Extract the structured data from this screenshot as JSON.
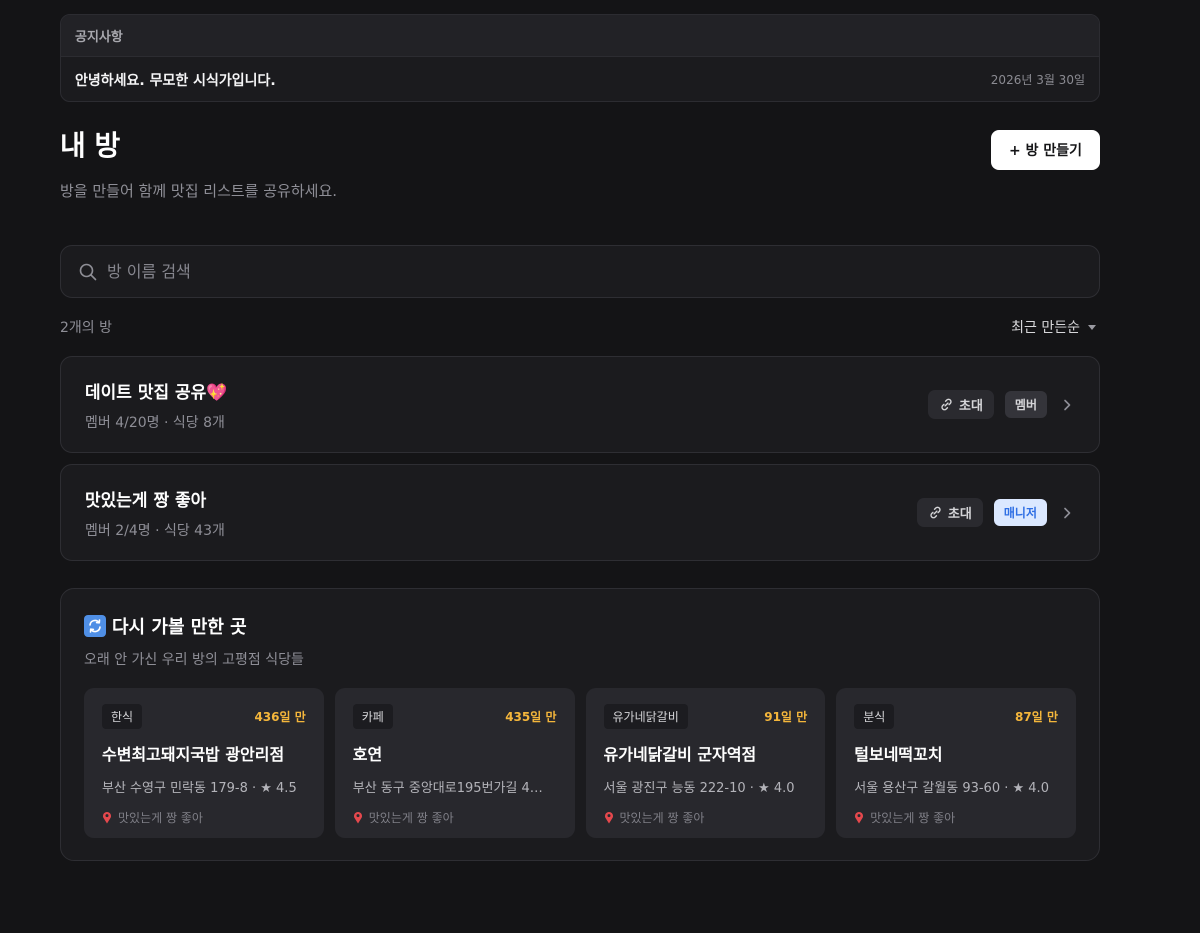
{
  "notice": {
    "header": "공지사항",
    "text": "안녕하세요. 무모한 시식가입니다.",
    "date": "2026년 3월 30일"
  },
  "header": {
    "title": "내 방",
    "subtitle": "방을 만들어 함께 맛집 리스트를 공유하세요.",
    "create_button": "+ 방 만들기"
  },
  "search": {
    "placeholder": "방 이름 검색",
    "icon": "search-icon"
  },
  "list": {
    "count": "2개의 방",
    "sort": "최근 만든순"
  },
  "rooms": [
    {
      "name": "데이트 맛집 공유💖",
      "info": "멤버 4/20명 · 식당 8개",
      "invite": "초대",
      "role": "멤버",
      "role_type": "member"
    },
    {
      "name": "맛있는게 짱 좋아",
      "info": "멤버 2/4명 · 식당 43개",
      "invite": "초대",
      "role": "매니저",
      "role_type": "manager"
    }
  ],
  "revisit": {
    "title": "다시 가볼 만한 곳",
    "subtitle": "오래 안 가신 우리 방의 고평점 식당들",
    "cards": [
      {
        "category": "한식",
        "ago": "436일 만",
        "name": "수변최고돼지국밥 광안리점",
        "address": "부산 수영구 민락동 179-8 · ★ 4.5",
        "room": "맛있는게 짱 좋아"
      },
      {
        "category": "카페",
        "ago": "435일 만",
        "name": "호연",
        "address": "부산 동구 중앙대로195번가길 4…",
        "room": "맛있는게 짱 좋아"
      },
      {
        "category": "유가네닭갈비",
        "ago": "91일 만",
        "name": "유가네닭갈비 군자역점",
        "address": "서울 광진구 능동 222-10 · ★ 4.0",
        "room": "맛있는게 짱 좋아"
      },
      {
        "category": "분식",
        "ago": "87일 만",
        "name": "털보네떡꼬치",
        "address": "서울 용산구 갈월동 93-60 · ★ 4.0",
        "room": "맛있는게 짱 좋아"
      }
    ]
  },
  "colors": {
    "background": "#141416",
    "accent_days": "#f4b63b",
    "manager_badge": "#dbe8ff",
    "manager_text": "#2f6fe4"
  }
}
